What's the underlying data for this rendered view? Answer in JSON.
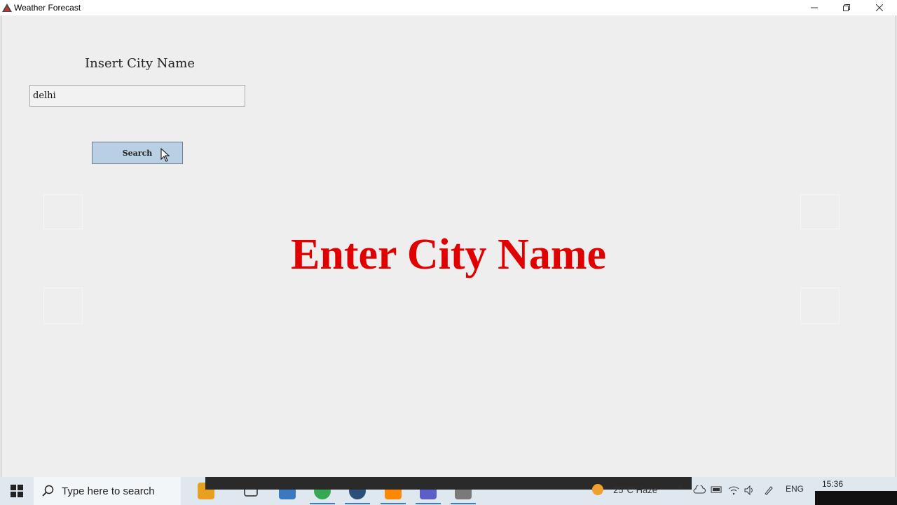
{
  "window": {
    "title": "Weather Forecast"
  },
  "form": {
    "label": "Insert City Name",
    "city_value": "delhi",
    "search_label": "Search"
  },
  "main": {
    "message": "Enter City Name"
  },
  "colors": {
    "message": "#e00000",
    "button": "#b8cfe4",
    "background": "#eeeeee"
  },
  "taskbar": {
    "search_placeholder": "Type here to search",
    "weather": "25°C  Haze",
    "language": "ENG",
    "time": "15:36"
  },
  "icons": [
    "windows-logo-icon",
    "search-icon",
    "file-explorer-icon",
    "task-view-icon",
    "store-icon",
    "chrome-icon",
    "app-icon",
    "vlc-icon",
    "app-icon-2",
    "photos-icon",
    "cloud-icon",
    "battery-icon",
    "wifi-icon",
    "volume-icon",
    "pen-icon"
  ]
}
